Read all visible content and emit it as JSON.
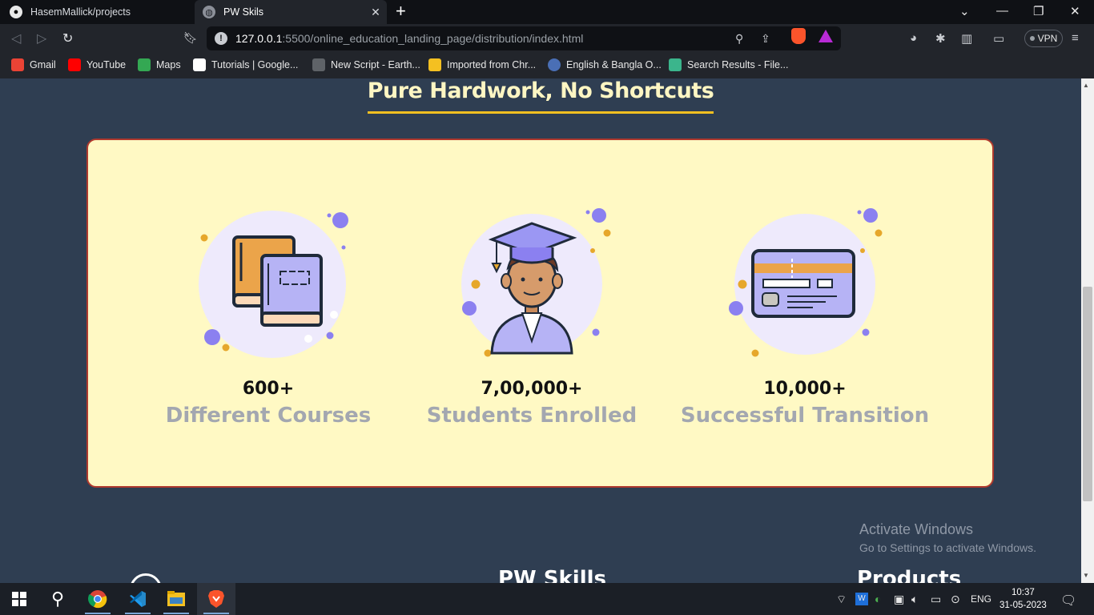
{
  "browser": {
    "tabs": [
      {
        "title": "HasemMallick/projects",
        "active": false,
        "icon": "github-icon"
      },
      {
        "title": "PW Skils",
        "active": true,
        "icon": "globe-icon"
      }
    ],
    "url_host": "127.0.0.1",
    "url_path": ":5500/online_education_landing_page/distribution/index.html",
    "vpn_label": "VPN",
    "bookmarks": [
      {
        "label": "Gmail",
        "icon": "gmail-icon",
        "color": "#ea4335"
      },
      {
        "label": "YouTube",
        "icon": "youtube-icon",
        "color": "#ff0000"
      },
      {
        "label": "Maps",
        "icon": "maps-icon",
        "color": "#34a853"
      },
      {
        "label": "Tutorials  |  Google...",
        "icon": "google-icon",
        "color": "#ffffff"
      },
      {
        "label": "New Script - Earth...",
        "icon": "earth-engine-icon",
        "color": "#5f6368"
      },
      {
        "label": "Imported from Chr...",
        "icon": "folder-icon",
        "color": "#f4c021"
      },
      {
        "label": "English & Bangla O...",
        "icon": "dictionary-icon",
        "color": "#4a6fb5"
      },
      {
        "label": "Search Results - File...",
        "icon": "filehippo-icon",
        "color": "#3bb58c"
      }
    ]
  },
  "page": {
    "section_title": "Pure Hardwork, No Shortcuts",
    "stats": [
      {
        "value": "600+",
        "label": "Different Courses",
        "icon": "books-icon"
      },
      {
        "value": "7,00,000+",
        "label": "Students Enrolled",
        "icon": "graduate-student-icon"
      },
      {
        "value": "10,000+",
        "label": "Successful Transition",
        "icon": "credit-card-icon"
      }
    ],
    "footer_peek": {
      "brand": "PW Skills",
      "products": "Products"
    }
  },
  "overlay": {
    "activate_title": "Activate Windows",
    "activate_sub": "Go to Settings to activate Windows."
  },
  "taskbar": {
    "language": "ENG",
    "time": "10:37",
    "date": "31-05-2023"
  },
  "colors": {
    "page_bg": "#2f3e52",
    "card_bg": "#fff9c4",
    "title": "#fef6c3",
    "underline": "#f4c021",
    "label_gray": "#a3a7b0",
    "illus_circle": "#eeeafc",
    "accent_purple": "#8b80f0",
    "accent_orange": "#e6a72b"
  }
}
